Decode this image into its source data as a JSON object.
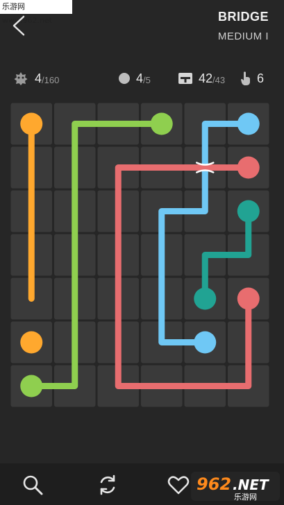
{
  "watermark": "乐游网 www.962.net",
  "header": {
    "title": "BRIDGE",
    "subtitle": "MEDIUM I"
  },
  "stats": {
    "levels": {
      "value": "4",
      "total": "/160"
    },
    "bridges": {
      "value": "4",
      "total": "/5"
    },
    "moves": {
      "value": "42",
      "total": "/43"
    },
    "hints": {
      "value": "6"
    }
  },
  "board": {
    "cols": 6,
    "rows": 7,
    "paths": [
      {
        "color": "#ffa82e",
        "name": "orange",
        "points": [
          [
            0,
            0
          ],
          [
            0,
            4
          ]
        ]
      },
      {
        "color": "#8fcf4f",
        "name": "green",
        "points": [
          [
            3,
            0
          ],
          [
            1,
            0
          ],
          [
            1,
            6
          ],
          [
            0,
            6
          ]
        ]
      },
      {
        "color": "#6fc8f5",
        "name": "blue",
        "points": [
          [
            5,
            0
          ],
          [
            4,
            0
          ],
          [
            4,
            2
          ],
          [
            3,
            2
          ],
          [
            3,
            5
          ],
          [
            4,
            5
          ]
        ]
      },
      {
        "color": "#e86d6f",
        "name": "red",
        "points": [
          [
            5,
            1
          ],
          [
            2,
            1
          ],
          [
            2,
            6
          ],
          [
            5,
            6
          ],
          [
            5,
            4
          ]
        ]
      },
      {
        "color": "#21a393",
        "name": "teal",
        "points": [
          [
            5,
            2
          ],
          [
            5,
            3
          ],
          [
            4,
            3
          ],
          [
            4,
            4
          ]
        ]
      }
    ],
    "dots": [
      {
        "color": "#ffa82e",
        "cell": [
          0,
          0
        ]
      },
      {
        "color": "#ffa82e",
        "cell": [
          0,
          5
        ]
      },
      {
        "color": "#8fcf4f",
        "cell": [
          3,
          0
        ]
      },
      {
        "color": "#8fcf4f",
        "cell": [
          0,
          6
        ]
      },
      {
        "color": "#6fc8f5",
        "cell": [
          5,
          0
        ]
      },
      {
        "color": "#6fc8f5",
        "cell": [
          4,
          5
        ]
      },
      {
        "color": "#e86d6f",
        "cell": [
          5,
          1
        ]
      },
      {
        "color": "#e86d6f",
        "cell": [
          5,
          4
        ]
      },
      {
        "color": "#21a393",
        "cell": [
          5,
          2
        ]
      },
      {
        "color": "#21a393",
        "cell": [
          4,
          4
        ]
      }
    ],
    "bridge_cell": [
      4,
      1
    ]
  },
  "toolbar": {
    "search_icon": "search-icon",
    "restart_icon": "restart-icon",
    "like_icon": "heart-icon"
  },
  "logo": {
    "brand": "962",
    "suffix": ".NET",
    "cn": "乐游网"
  }
}
